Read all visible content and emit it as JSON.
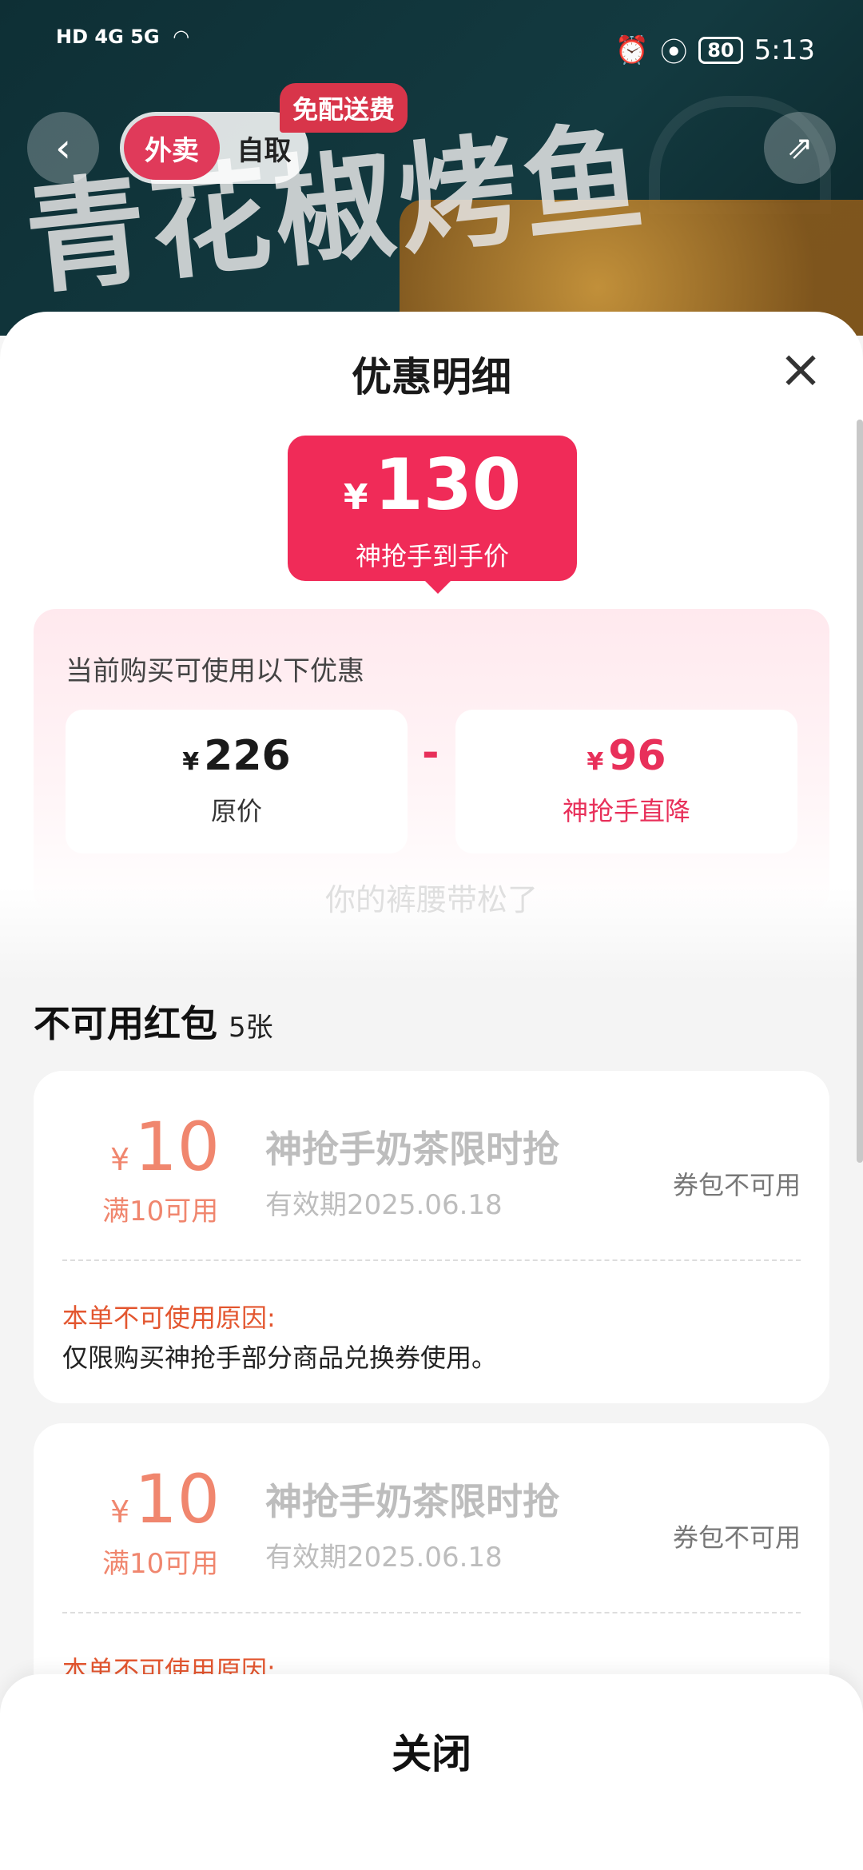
{
  "status": {
    "left_text": "HD 4G 5G",
    "time": "5:13",
    "battery": "80"
  },
  "header": {
    "back_icon": "chevron-left-icon",
    "tab_delivery": "外卖",
    "tab_pickup": "自取",
    "free_delivery_badge": "免配送费",
    "share_icon": "share-icon",
    "banner_title": "青花椒烤鱼"
  },
  "sheet": {
    "title": "优惠明细",
    "close_icon": "close-icon",
    "final_price": {
      "currency": "¥",
      "value": "130",
      "label": "神抢手到手价"
    },
    "discount_panel": {
      "label": "当前购买可使用以下优惠",
      "original": {
        "currency": "¥",
        "value": "226",
        "label": "原价"
      },
      "operator": "-",
      "discount": {
        "currency": "¥",
        "value": "96",
        "label": "神抢手直降"
      }
    },
    "watermark": "你的裤腰带松了",
    "unavailable": {
      "title": "不可用红包",
      "count": "5张",
      "coupons": [
        {
          "currency": "¥",
          "amount": "10",
          "condition": "满10可用",
          "name": "神抢手奶茶限时抢",
          "expiry": "有效期2025.06.18",
          "state": "券包不可用",
          "reason_title": "本单不可使用原因:",
          "reason": "仅限购买神抢手部分商品兑换券使用。"
        },
        {
          "currency": "¥",
          "amount": "10",
          "condition": "满10可用",
          "name": "神抢手奶茶限时抢",
          "expiry": "有效期2025.06.18",
          "state": "券包不可用",
          "reason_title": "本单不可使用原因:",
          "reason": ""
        }
      ]
    },
    "close_button": "关闭"
  },
  "colors": {
    "accent": "#f02b58",
    "coupon_amount": "#f0866e",
    "reason_title": "#e3562f"
  }
}
